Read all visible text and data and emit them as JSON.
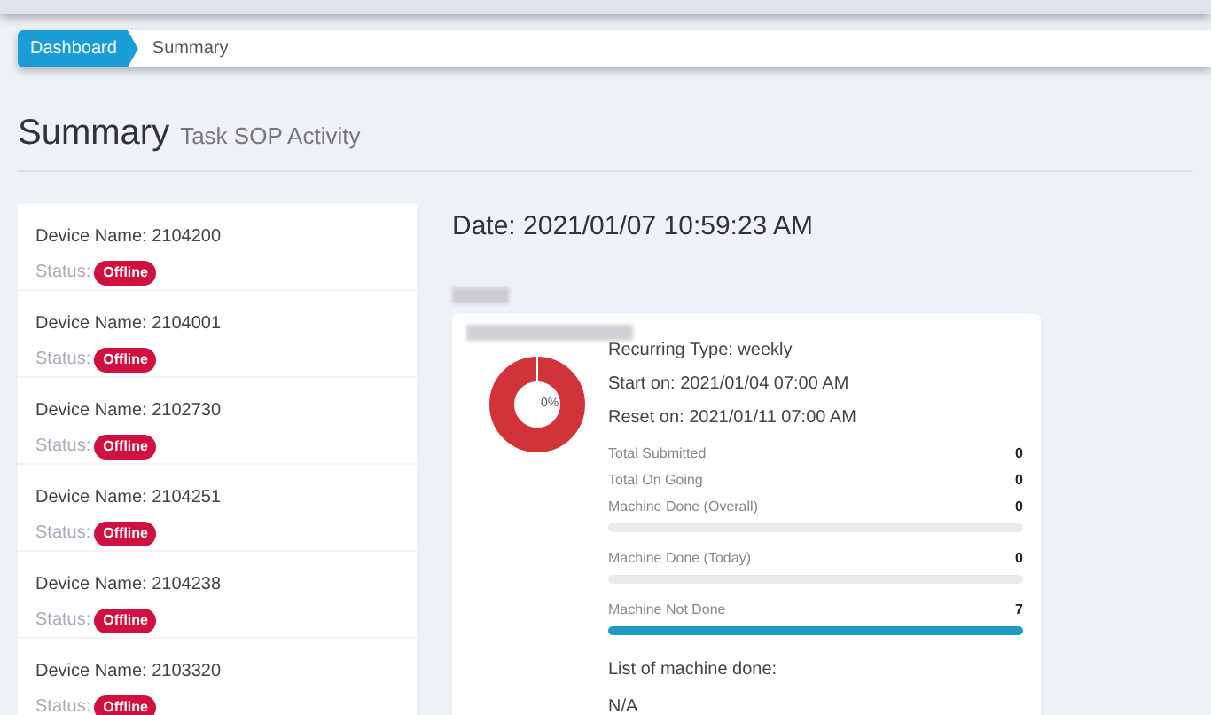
{
  "breadcrumb": [
    {
      "label": "Dashboard",
      "selected": true
    },
    {
      "label": "Summary",
      "selected": false
    }
  ],
  "page_title": {
    "title": "Summary",
    "subtitle": "Task SOP Activity"
  },
  "devices": [
    {
      "name": "Device Name: 2104200",
      "status_label": "Status:",
      "status": "Offline",
      "online": false
    },
    {
      "name": "Device Name: 2104001",
      "status_label": "Status:",
      "status": "Offline",
      "online": false
    },
    {
      "name": "Device Name: 2102730",
      "status_label": "Status:",
      "status": "Offline",
      "online": false
    },
    {
      "name": "Device Name: 2104251",
      "status_label": "Status:",
      "status": "Offline",
      "online": false
    },
    {
      "name": "Device Name: 2104238",
      "status_label": "Status:",
      "status": "Offline",
      "online": false
    },
    {
      "name": "Device Name: 2103320",
      "status_label": "Status:",
      "status": "Offline",
      "online": false
    }
  ],
  "date": "Date: 2021/01/07 10:59:23 AM",
  "task_card": {
    "donut_label": "0%",
    "info": [
      "Recurring Type: weekly",
      "Start on: 2021/01/04 07:00 AM",
      "Reset on: 2021/01/11 07:00 AM"
    ],
    "stats": [
      {
        "kind": "plain",
        "label": "Total Submitted",
        "value": "0"
      },
      {
        "kind": "plain",
        "label": "Total On Going",
        "value": "0"
      },
      {
        "kind": "bar",
        "label": "Machine Done (Overall)",
        "value": "0",
        "level": 0
      },
      {
        "kind": "bar",
        "label": "Machine Done (Today)",
        "value": "0",
        "level": 0
      },
      {
        "kind": "bar",
        "label": "Machine Not Done",
        "value": "7",
        "level": 1
      }
    ],
    "list_title": "List of machine done:",
    "list_value": "N/A"
  }
}
